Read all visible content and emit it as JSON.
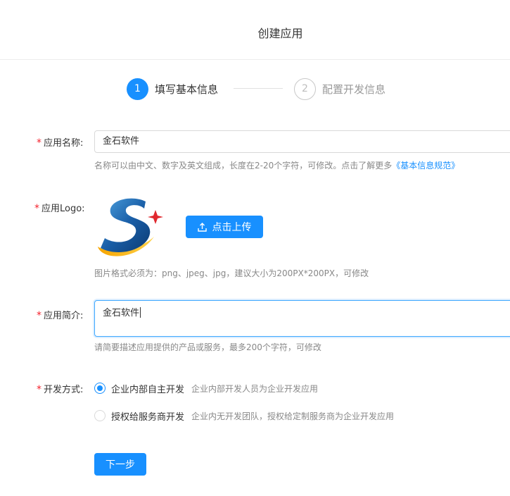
{
  "header": {
    "title": "创建应用"
  },
  "steps": [
    {
      "number": "1",
      "label": "填写基本信息"
    },
    {
      "number": "2",
      "label": "配置开发信息"
    }
  ],
  "form": {
    "required_mark": "*",
    "name": {
      "label": "应用名称:",
      "value": "金石软件",
      "help": "名称可以由中文、数字及英文组成，长度在2-20个字符，可修改。点击了解更多",
      "help_link": "《基本信息规范》"
    },
    "logo": {
      "label": "应用Logo:",
      "upload_label": "点击上传",
      "help": "图片格式必须为：png、jpeg、jpg，建议大小为200PX*200PX，可修改"
    },
    "desc": {
      "label": "应用简介:",
      "value": "金石软件",
      "help": "请简要描述应用提供的产品或服务，最多200个字符，可修改"
    },
    "dev_mode": {
      "label": "开发方式:",
      "options": [
        {
          "label": "企业内部自主开发",
          "desc": "企业内部开发人员为企业开发应用",
          "checked": true
        },
        {
          "label": "授权给服务商开发",
          "desc": "企业内无开发团队，授权给定制服务商为企业开发应用",
          "checked": false
        }
      ]
    },
    "next_label": "下一步"
  },
  "colors": {
    "primary": "#1890ff",
    "required": "#f5222d"
  }
}
